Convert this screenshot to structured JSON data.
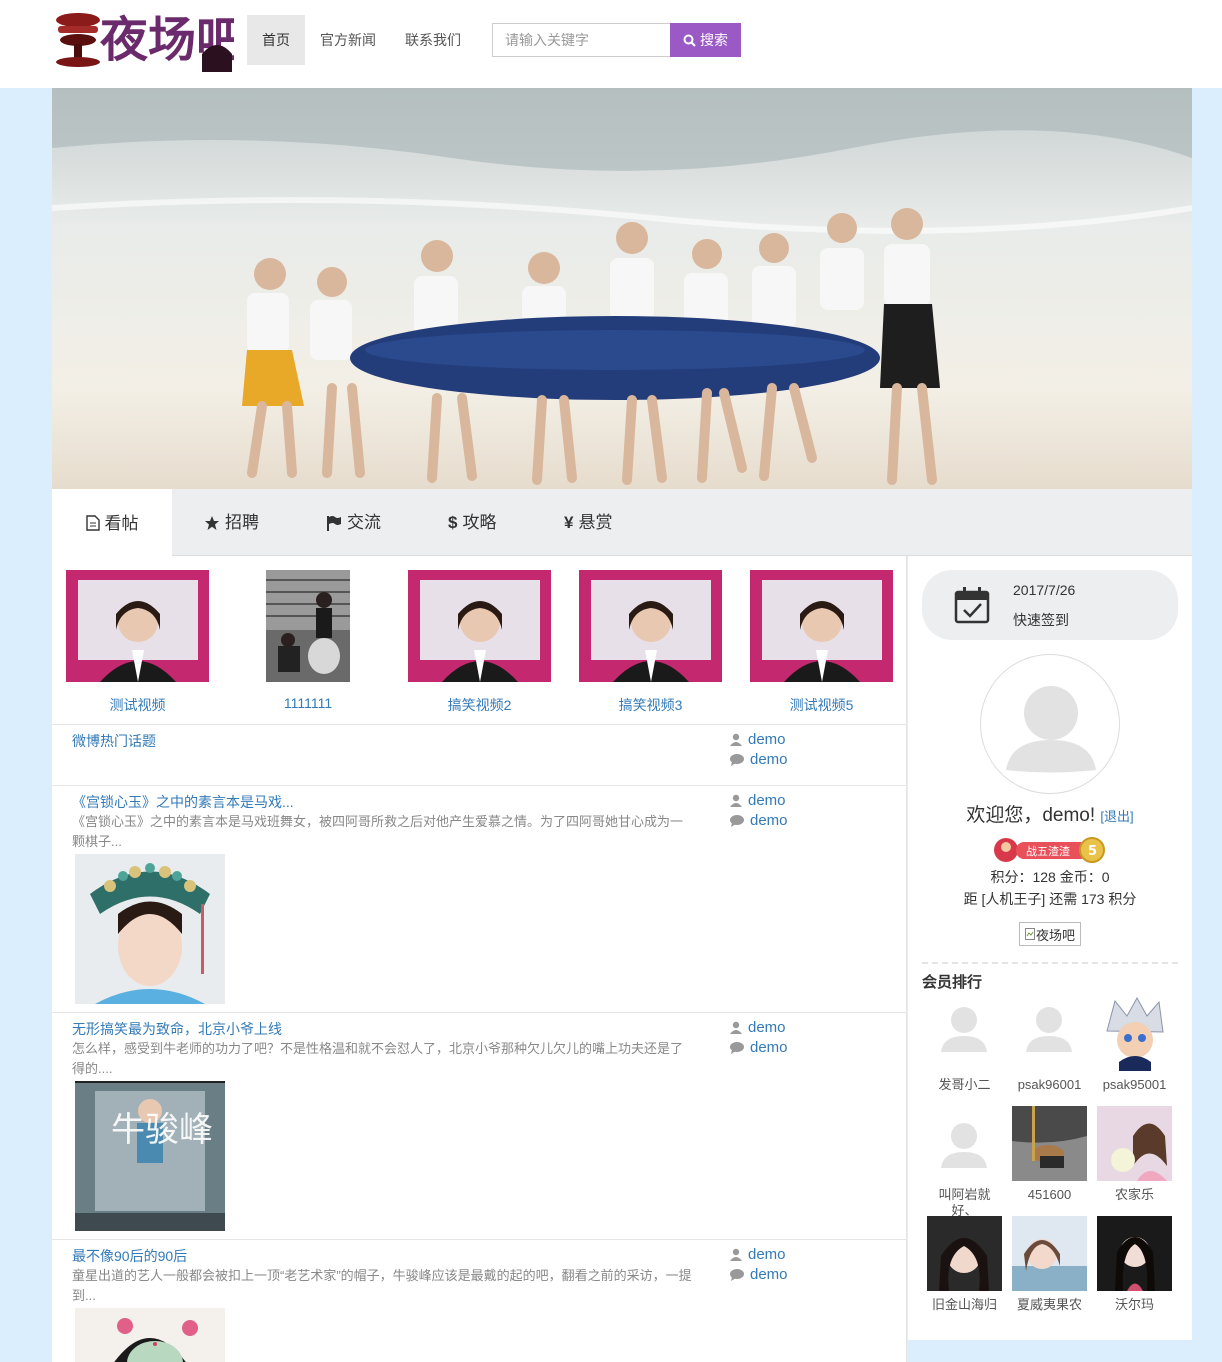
{
  "header": {
    "logo_text": "夜场吧",
    "nav": [
      {
        "label": "首页",
        "active": true
      },
      {
        "label": "官方新闻",
        "active": false
      },
      {
        "label": "联系我们",
        "active": false
      }
    ],
    "search": {
      "placeholder": "请输入关键字",
      "button_label": "搜索"
    }
  },
  "tabs": [
    {
      "label": "看帖",
      "icon": "document-icon"
    },
    {
      "label": "招聘",
      "icon": "star-icon"
    },
    {
      "label": "交流",
      "icon": "flag-icon"
    },
    {
      "label": "攻略",
      "icon": "dollar-icon"
    },
    {
      "label": "悬赏",
      "icon": "yen-icon"
    }
  ],
  "videos": [
    {
      "title": "测试视频"
    },
    {
      "title": "1111111"
    },
    {
      "title": "搞笑视频2"
    },
    {
      "title": "搞笑视频3"
    },
    {
      "title": "测试视频5"
    }
  ],
  "posts": [
    {
      "title": "微博热门话题",
      "excerpt": "",
      "author": "demo",
      "replier": "demo"
    },
    {
      "title": "《宫锁心玉》之中的素言本是马戏...",
      "excerpt": "《宫锁心玉》之中的素言本是马戏班舞女，被四阿哥所救之后对他产生爱慕之情。为了四阿哥她甘心成为一颗棋子...",
      "author": "demo",
      "replier": "demo"
    },
    {
      "title": "无形搞笑最为致命，北京小爷上线",
      "excerpt": "怎么样，感受到牛老师的功力了吧？不是性格温和就不会怼人了，北京小爷那种欠儿欠儿的嘴上功夫还是了得的....",
      "author": "demo",
      "replier": "demo",
      "image_text": "牛骏峰"
    },
    {
      "title": "最不像90后的90后",
      "excerpt": "童星出道的艺人一般都会被扣上一顶“老艺术家”的帽子，牛骏峰应该是最戴的起的吧，翻看之前的采访，一提到...",
      "author": "demo",
      "replier": "demo"
    }
  ],
  "sidebar": {
    "checkin_date": "2017/7/26",
    "checkin_label": "快速签到",
    "welcome": "欢迎您，demo!",
    "logout": "[退出]",
    "badge_text": "战五渣渣",
    "badge_level": "5",
    "points": "积分：128 金币：0",
    "next_rank": "距 [人机王子] 还需 173 积分",
    "logo_alt": "夜场吧",
    "rank_title": "会员排行",
    "members": [
      {
        "name": "发哥小二"
      },
      {
        "name": "psak96001"
      },
      {
        "name": "psak95001"
      },
      {
        "name": "叫阿岩就好、"
      },
      {
        "name": "451600"
      },
      {
        "name": "农家乐"
      },
      {
        "name": "旧金山海归"
      },
      {
        "name": "夏威夷果农"
      },
      {
        "name": "沃尔玛"
      }
    ]
  },
  "colors": {
    "accent": "#9b59c6",
    "link": "#337ab7",
    "page_bg": "#dbeefe"
  }
}
